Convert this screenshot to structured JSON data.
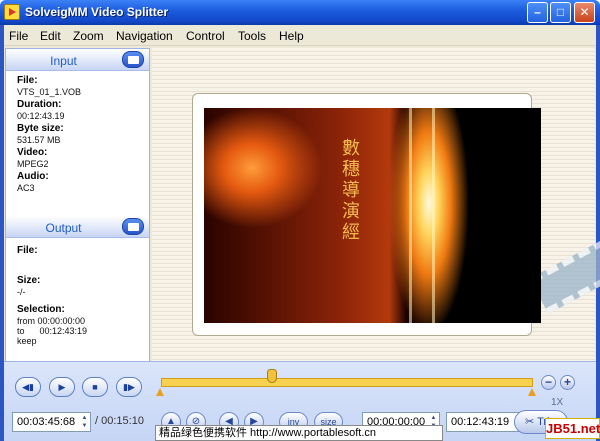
{
  "window": {
    "title": "SolveigMM Video Splitter",
    "min": "–",
    "max": "□",
    "close": "✕"
  },
  "menu": [
    "File",
    "Edit",
    "Zoom",
    "Navigation",
    "Control",
    "Tools",
    "Help"
  ],
  "input": {
    "header": "Input",
    "file_label": "File:",
    "file_value": "VTS_01_1.VOB",
    "duration_label": "Duration:",
    "duration_value": "00:12:43.19",
    "bytesize_label": "Byte size:",
    "bytesize_value": "531.57 MB",
    "video_label": "Video:",
    "video_value": "MPEG2",
    "audio_label": "Audio:",
    "audio_value": "AC3"
  },
  "output": {
    "header": "Output",
    "file_label": "File:",
    "size_label": "Size:",
    "size_value": "-/-",
    "selection_label": "Selection:",
    "from_line": "from 00:00:00:00",
    "to_line": "to      00:12:43:19",
    "keep_line": "keep"
  },
  "video_caption_chars": "數穗導演經",
  "controls": {
    "prev": "◀▮",
    "play": "▶",
    "stop": "■",
    "next": "▮▶",
    "zoom_out": "−",
    "zoom_in": "+",
    "zoom_level": "1X",
    "current_time": "00:03:45:68",
    "total_time": "/ 00:15:10",
    "inv": "inv",
    "size": "size",
    "start_time": "00:00:00:00",
    "end_time": "00:12:43:19",
    "trim": "Trim",
    "trim_icon": "✂"
  },
  "timeline": {
    "position_fraction": 0.298
  },
  "watermark": "精品绿色便携软件 http://www.portablesoft.cn",
  "badge": "JB51.net"
}
